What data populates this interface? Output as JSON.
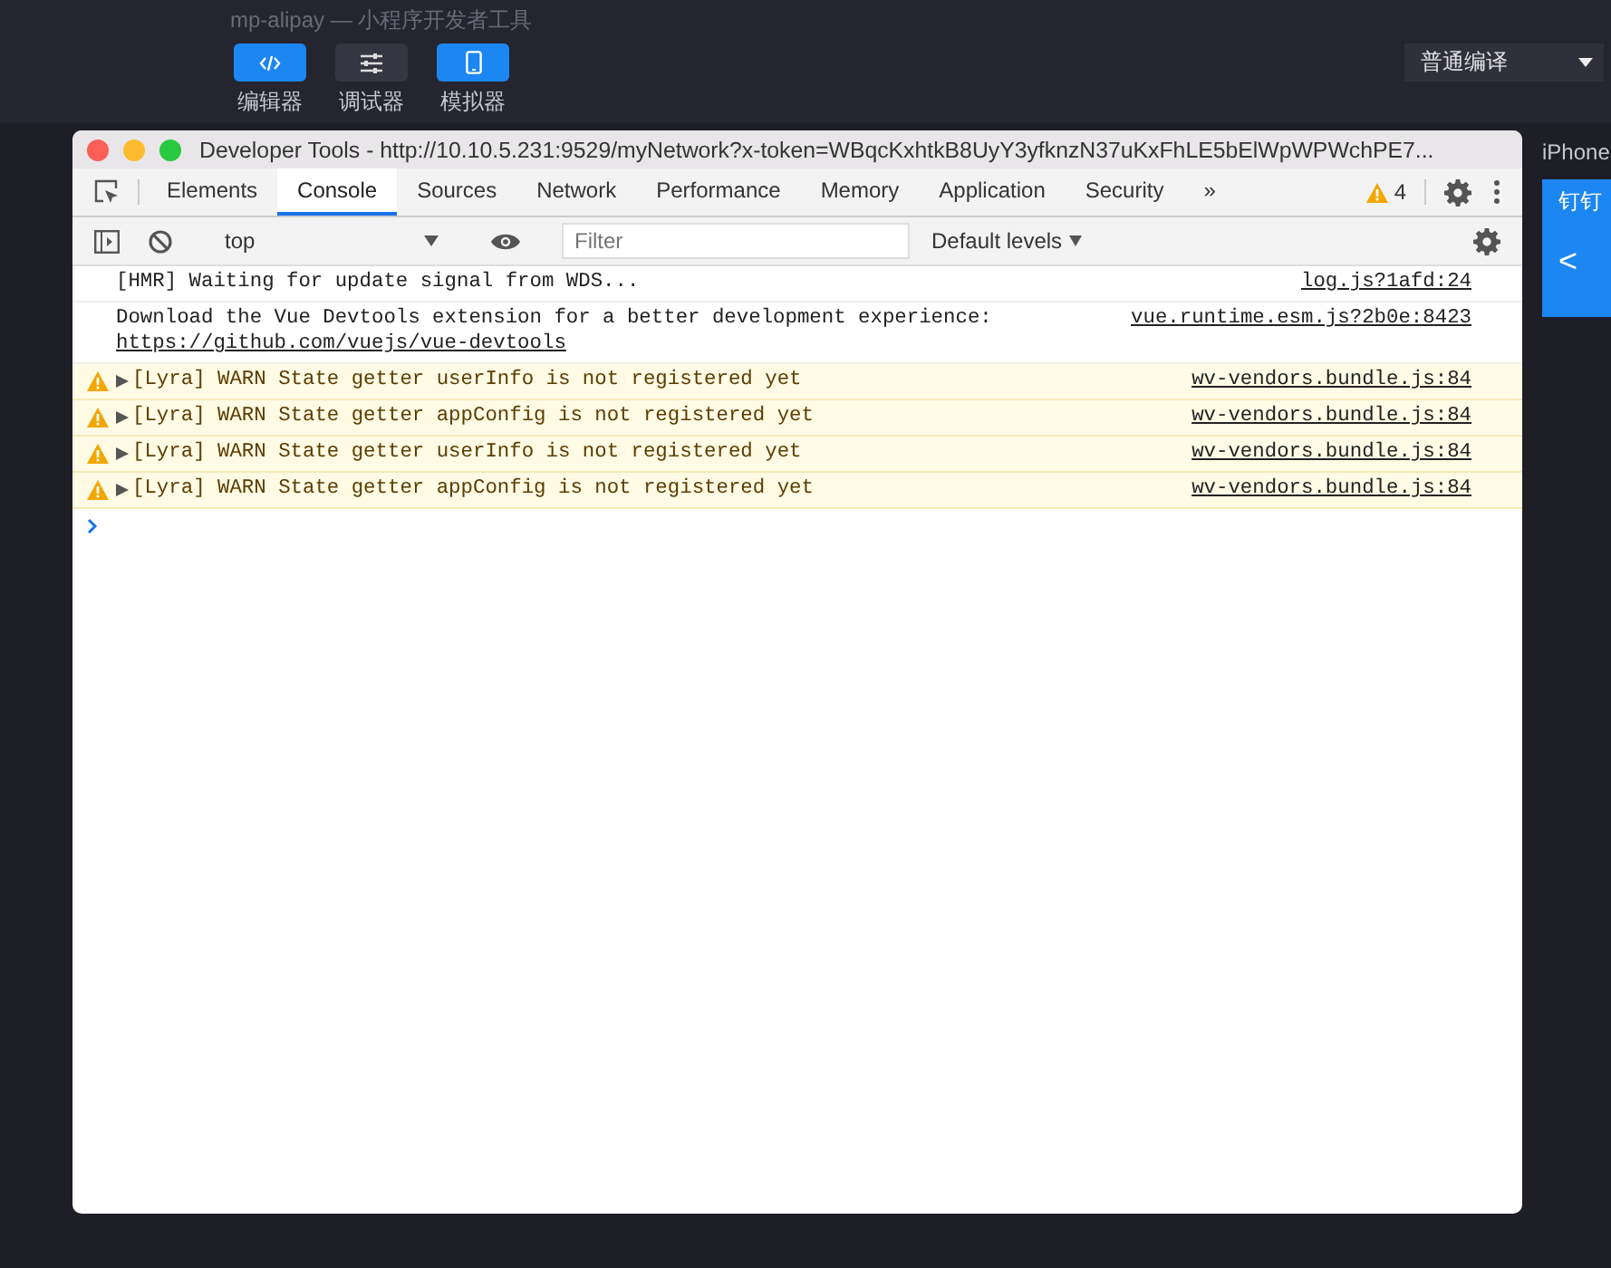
{
  "app": {
    "title": "mp-alipay — 小程序开发者工具",
    "modes": [
      {
        "label": "编辑器",
        "kind": "code",
        "selected": true
      },
      {
        "label": "调试器",
        "kind": "sliders",
        "selected": false
      },
      {
        "label": "模拟器",
        "kind": "phone",
        "selected": true
      }
    ],
    "compile_select": {
      "value": "普通编译"
    }
  },
  "simulator": {
    "device": "iPhone",
    "nav_title": "钉钉",
    "back": "<"
  },
  "devtools": {
    "title": "Developer Tools - http://10.10.5.231:9529/myNetwork?x-token=WBqcKxhtkB8UyY3yfknzN37uKxFhLE5bElWpWPWchPE7...",
    "tabs": [
      {
        "label": "Elements",
        "selected": false
      },
      {
        "label": "Console",
        "selected": true
      },
      {
        "label": "Sources",
        "selected": false
      },
      {
        "label": "Network",
        "selected": false
      },
      {
        "label": "Performance",
        "selected": false
      },
      {
        "label": "Memory",
        "selected": false
      },
      {
        "label": "Application",
        "selected": false
      },
      {
        "label": "Security",
        "selected": false
      }
    ],
    "more_tabs": "»",
    "warning_count": "4",
    "context_select": {
      "value": "top"
    },
    "filter": {
      "placeholder": "Filter"
    },
    "levels_select": {
      "value": "Default levels"
    },
    "messages": [
      {
        "kind": "log",
        "text": "[HMR] Waiting for update signal from WDS...",
        "source": "log.js?1afd:24"
      },
      {
        "kind": "log",
        "text": "Download the Vue Devtools extension for a better development experience:",
        "link": "https://github.com/vuejs/vue-devtools",
        "source": "vue.runtime.esm.js?2b0e:8423"
      },
      {
        "kind": "warn",
        "expanded": false,
        "text": "[Lyra] WARN State getter userInfo is not registered yet",
        "source": "wv-vendors.bundle.js:84"
      },
      {
        "kind": "warn",
        "expanded": false,
        "text": "[Lyra] WARN State getter appConfig is not registered yet",
        "source": "wv-vendors.bundle.js:84"
      },
      {
        "kind": "warn",
        "expanded": false,
        "text": "[Lyra] WARN State getter userInfo is not registered yet",
        "source": "wv-vendors.bundle.js:84"
      },
      {
        "kind": "warn",
        "expanded": false,
        "text": "[Lyra] WARN State getter appConfig is not registered yet",
        "source": "wv-vendors.bundle.js:84"
      }
    ]
  }
}
